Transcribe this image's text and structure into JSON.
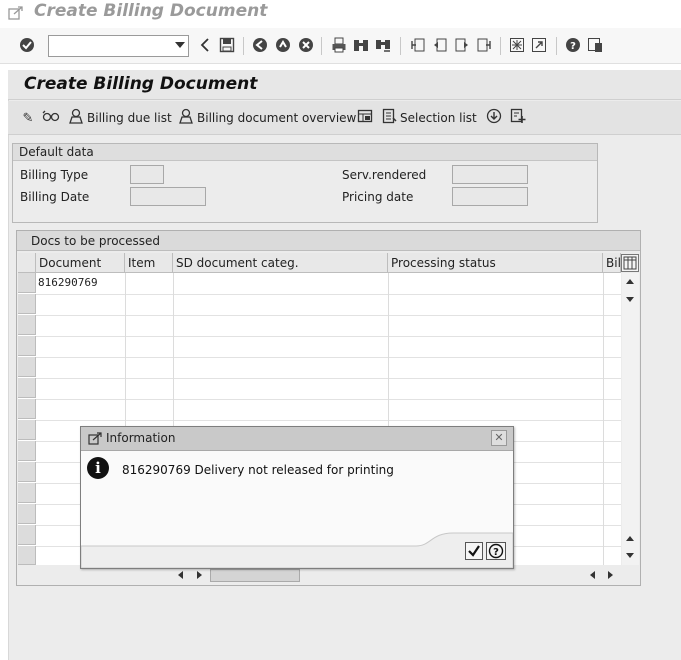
{
  "window": {
    "title": "Create Billing Document"
  },
  "std_toolbar": {
    "icons": [
      "enter-icon",
      "back-icon",
      "save-icon",
      "back-arrow-icon",
      "exit-icon",
      "cancel-icon",
      "print-icon",
      "find-icon",
      "find-next-icon",
      "first-page-icon",
      "previous-page-icon",
      "next-page-icon",
      "last-page-icon",
      "new-session-icon",
      "shortcut-icon",
      "help-icon",
      "layout-icon"
    ],
    "command_field": {
      "value": ""
    }
  },
  "page": {
    "title": "Create Billing Document"
  },
  "app_toolbar": {
    "billing_due_list": "Billing due list",
    "billing_doc_overview": "Billing document overview",
    "selection_list": "Selection list"
  },
  "default_data": {
    "title": "Default data",
    "billing_type_label": "Billing Type",
    "billing_type_value": "",
    "billing_date_label": "Billing Date",
    "billing_date_value": "",
    "serv_rendered_label": "Serv.rendered",
    "serv_rendered_value": "",
    "pricing_date_label": "Pricing date",
    "pricing_date_value": ""
  },
  "docs_table": {
    "title": "Docs to be processed",
    "columns": [
      "Document",
      "Item",
      "SD document categ.",
      "Processing status",
      "Billi"
    ],
    "rows": [
      {
        "document": "816290769",
        "item": "",
        "category": "",
        "status": ""
      }
    ]
  },
  "dialog": {
    "title": "Information",
    "message": "816290769 Delivery not released for printing"
  }
}
